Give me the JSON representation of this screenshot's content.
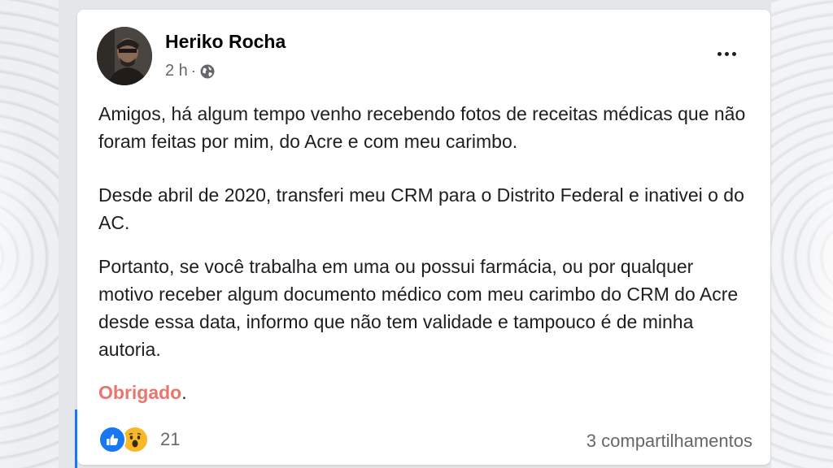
{
  "post": {
    "author": "Heriko Rocha",
    "time": "2 h",
    "separator": "·",
    "privacy_icon": "globe-icon",
    "paragraphs": [
      "Amigos, há algum tempo venho recebendo fotos de receitas médicas que não foram feitas por mim, do Acre e com meu carimbo.",
      "Desde abril de 2020, transferi meu CRM para o Distrito Federal e inativei o do AC.",
      "Portanto, se você trabalha em uma ou possui farmácia, ou por qualquer motivo receber algum documento médico com meu carimbo do CRM do Acre desde essa data, informo que não tem validade e tampouco é de minha autoria."
    ],
    "thanks": "Obrigado",
    "thanks_period": "."
  },
  "reactions": {
    "icons": [
      "like-icon",
      "wow-icon"
    ],
    "count": "21"
  },
  "shares_label": "3 compartilhamentos",
  "colors": {
    "accent": "#1877f2",
    "thanks": "#e8766d",
    "secondary_text": "#65676b"
  }
}
